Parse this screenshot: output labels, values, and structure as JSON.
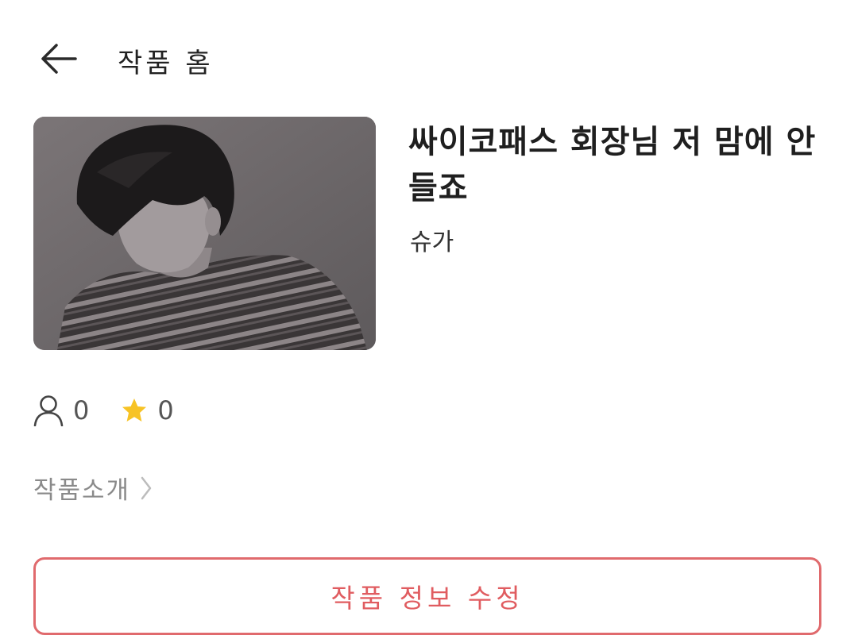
{
  "header": {
    "title": "작품 홈",
    "back_icon": "arrow-left-icon"
  },
  "work": {
    "title": "싸이코패스 회장님 저 맘에 안 들죠",
    "author": "슈가",
    "cover_image": "cover-photo"
  },
  "stats": {
    "readers_icon": "person-icon",
    "readers": "0",
    "favorites_icon": "star-icon",
    "favorites": "0",
    "star_color": "#f7c325"
  },
  "intro": {
    "label": "작품소개",
    "icon": "chevron-right-icon"
  },
  "actions": {
    "edit_label": "작품 정보 수정",
    "accent_color": "#e05c60"
  }
}
